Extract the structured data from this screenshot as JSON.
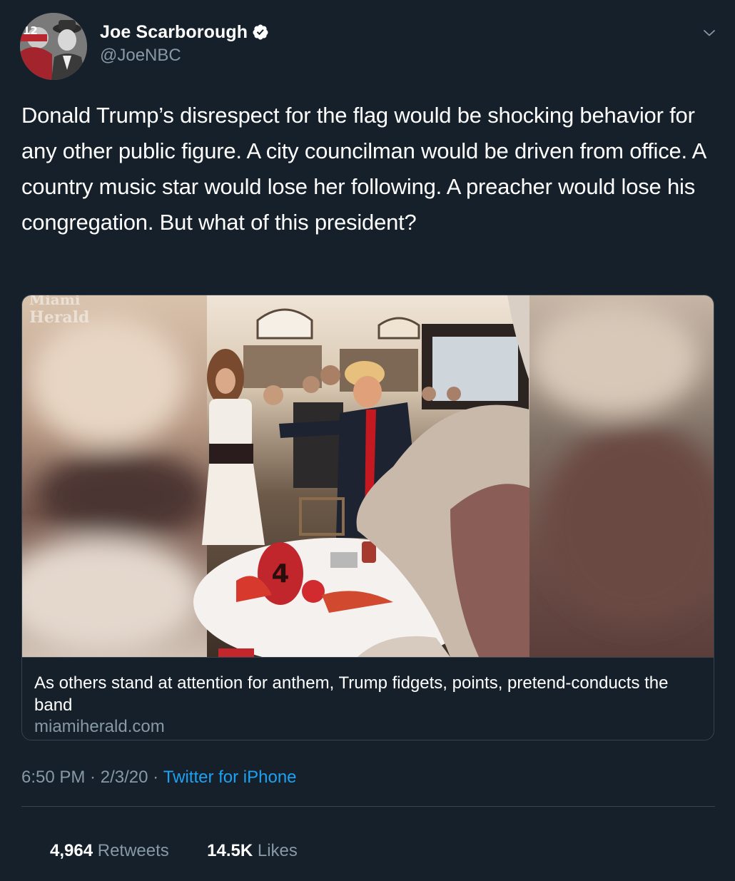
{
  "author": {
    "display_name": "Joe Scarborough",
    "handle": "@JoeNBC",
    "verified": true,
    "avatar_icon": "profile-photo",
    "avatar_jersey_text": "12"
  },
  "tweet": {
    "text": "Donald Trump’s disrespect for the flag would be shocking behavior for any other public figure. A city councilman would be driven from office. A country music star would lose her following. A preacher would lose his congregation. But what of this president?"
  },
  "card": {
    "watermark_line1": "Miami",
    "watermark_line2": "Herald",
    "table_number": "4",
    "title": "As others stand at attention for anthem, Trump fidgets, points, pretend-conducts the band",
    "domain": "miamiherald.com"
  },
  "meta": {
    "time": "6:50 PM",
    "date": "2/3/20",
    "separator": " · ",
    "source": "Twitter for iPhone"
  },
  "stats": {
    "retweets_count": "4,964",
    "retweets_label": "Retweets",
    "likes_count": "14.5K",
    "likes_label": "Likes"
  },
  "colors": {
    "background": "#15202b",
    "text_primary": "#ffffff",
    "text_secondary": "#8899a6",
    "accent": "#1da1f2",
    "border": "#38444d"
  },
  "icons": {
    "verified": "verified-badge-icon",
    "more": "chevron-down-icon"
  }
}
